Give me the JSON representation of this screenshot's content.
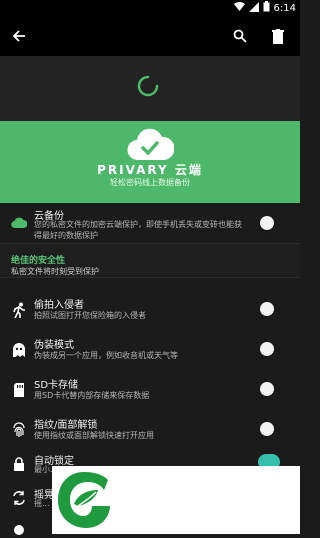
{
  "status": {
    "time": "6:14"
  },
  "app": {
    "back_label": "",
    "brand": "PRIVARY 云端",
    "brand_sub": "轻松密码线上数据备份"
  },
  "rows": [
    {
      "title": "云备份",
      "desc": "您的私密文件的加密云端保护，即使手机丢失或变砖也能获得最好的数据保护"
    },
    {
      "title": "偷拍入侵者",
      "desc": "拍照试图打开您保险箱的入侵者"
    },
    {
      "title": "伪装模式",
      "desc": "伪装成另一个应用，例如收音机或天气等"
    },
    {
      "title": "SD卡存储",
      "desc": "用SD卡代替内部存储来保存数据"
    },
    {
      "title": "指纹/面部解锁",
      "desc": "使用指纹或面部解锁快速打开应用"
    },
    {
      "title": "自动锁定",
      "desc": "最小..."
    },
    {
      "title": "摇晃",
      "desc": "摇..."
    },
    {
      "title": "",
      "desc": ""
    }
  ],
  "section": {
    "title": "绝佳的安全性",
    "subtitle": "私密文件将时刻受到保护"
  },
  "colors": {
    "accent": "#4db86a",
    "teal": "#34c0ad"
  }
}
